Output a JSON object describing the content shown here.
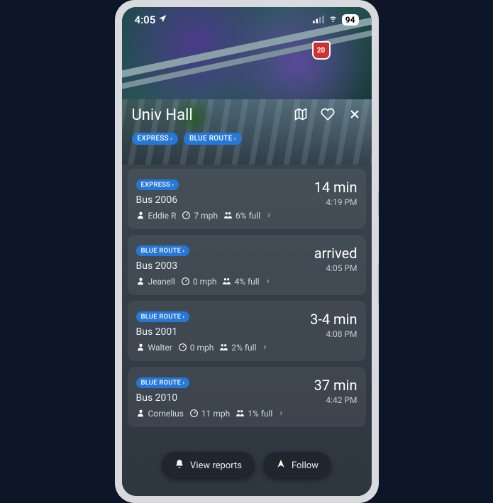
{
  "status": {
    "time": "4:05",
    "battery": "94",
    "interstate": "20"
  },
  "hero": {
    "title": "Univ Hall"
  },
  "filters": [
    {
      "label": "EXPRESS"
    },
    {
      "label": "BLUE ROUTE"
    }
  ],
  "buses": [
    {
      "route": "EXPRESS",
      "name": "Bus 2006",
      "driver": "Eddie R",
      "speed": "7 mph",
      "capacity": "6% full",
      "eta": "14 min",
      "eta_time": "4:19 PM"
    },
    {
      "route": "BLUE ROUTE",
      "name": "Bus 2003",
      "driver": "Jeanell",
      "speed": "0 mph",
      "capacity": "4% full",
      "eta": "arrived",
      "eta_time": "4:05 PM"
    },
    {
      "route": "BLUE ROUTE",
      "name": "Bus 2001",
      "driver": "Walter",
      "speed": "0 mph",
      "capacity": "2% full",
      "eta": "3-4 min",
      "eta_time": "4:08 PM"
    },
    {
      "route": "BLUE ROUTE",
      "name": "Bus 2010",
      "driver": "Cornelius",
      "speed": "11 mph",
      "capacity": "1% full",
      "eta": "37 min",
      "eta_time": "4:42 PM"
    }
  ],
  "actions": {
    "reports": "View reports",
    "follow": "Follow"
  }
}
